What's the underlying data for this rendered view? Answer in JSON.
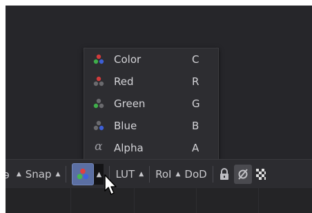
{
  "toolbar": {
    "edge_glyph": "ə",
    "snap_label": "Snap",
    "lut_label": "LUT",
    "roi_label": "RoI",
    "dod_label": "DoD"
  },
  "channel_menu": {
    "items": [
      {
        "label": "Color",
        "shortcut": "C",
        "icon": "rgb-dots-icon"
      },
      {
        "label": "Red",
        "shortcut": "R",
        "icon": "red-dots-icon"
      },
      {
        "label": "Green",
        "shortcut": "G",
        "icon": "green-dots-icon"
      },
      {
        "label": "Blue",
        "shortcut": "B",
        "icon": "blue-dots-icon"
      },
      {
        "label": "Alpha",
        "shortcut": "A",
        "icon": "alpha-icon"
      }
    ]
  },
  "colors": {
    "background": "#1f1f22",
    "menu_bg": "#2d2d31",
    "accent_button": "#5b6fa3",
    "red": "#d23b3b",
    "green": "#3fae4a",
    "blue": "#3d5fd6"
  },
  "alpha_glyph": "α",
  "triangle_glyph": "▲"
}
